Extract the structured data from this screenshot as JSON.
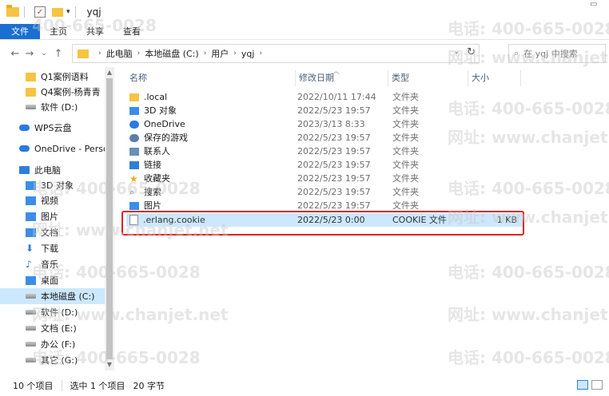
{
  "window": {
    "title": "yqj",
    "quick_access_dropdown": "▾"
  },
  "ribbon": {
    "tabs": [
      "文件",
      "主页",
      "共享",
      "查看"
    ]
  },
  "address": {
    "crumbs": [
      "此电脑",
      "本地磁盘 (C:)",
      "用户",
      "yqj"
    ],
    "search_placeholder": "在 yqj 中搜索"
  },
  "sidebar": {
    "items": [
      {
        "label": "Q1案例语料",
        "icon": "folder-icon"
      },
      {
        "label": "Q4案例-杨青青",
        "icon": "folder-icon"
      },
      {
        "label": "软件 (D:)",
        "icon": "drive-icon"
      },
      {
        "label": "WPS云盘",
        "icon": "cloud-icon"
      },
      {
        "label": "OneDrive - Person",
        "icon": "onedrive-icon"
      },
      {
        "label": "此电脑",
        "icon": "pc-icon"
      },
      {
        "label": "3D 对象",
        "icon": "cube-icon"
      },
      {
        "label": "视频",
        "icon": "video-icon"
      },
      {
        "label": "图片",
        "icon": "picture-icon"
      },
      {
        "label": "文档",
        "icon": "document-icon"
      },
      {
        "label": "下载",
        "icon": "download-icon"
      },
      {
        "label": "音乐",
        "icon": "music-icon"
      },
      {
        "label": "桌面",
        "icon": "desktop-icon"
      },
      {
        "label": "本地磁盘 (C:)",
        "icon": "drive-icon",
        "selected": true
      },
      {
        "label": "软件 (D:)",
        "icon": "drive-icon"
      },
      {
        "label": "文档 (E:)",
        "icon": "drive-icon"
      },
      {
        "label": "办公 (F:)",
        "icon": "drive-icon"
      },
      {
        "label": "其它 (G:)",
        "icon": "drive-icon"
      }
    ]
  },
  "columns": {
    "name": "名称",
    "date": "修改日期",
    "type": "类型",
    "size": "大小"
  },
  "files": [
    {
      "name": ".local",
      "date": "2022/10/11 17:44",
      "type": "文件夹",
      "size": "",
      "icon": "folder-icon"
    },
    {
      "name": "3D 对象",
      "date": "2022/5/23 19:57",
      "type": "文件夹",
      "size": "",
      "icon": "cube-icon"
    },
    {
      "name": "OneDrive",
      "date": "2023/3/13 8:33",
      "type": "文件夹",
      "size": "",
      "icon": "onedrive-icon"
    },
    {
      "name": "保存的游戏",
      "date": "2022/5/23 19:57",
      "type": "文件夹",
      "size": "",
      "icon": "games-icon"
    },
    {
      "name": "联系人",
      "date": "2022/5/23 19:57",
      "type": "文件夹",
      "size": "",
      "icon": "contacts-icon"
    },
    {
      "name": "链接",
      "date": "2022/5/23 19:57",
      "type": "文件夹",
      "size": "",
      "icon": "link-icon"
    },
    {
      "name": "收藏夹",
      "date": "2022/5/23 19:57",
      "type": "文件夹",
      "size": "",
      "icon": "star-icon"
    },
    {
      "name": "搜索",
      "date": "2022/5/23 19:57",
      "type": "文件夹",
      "size": "",
      "icon": "search-icon"
    },
    {
      "name": "图片",
      "date": "2022/5/23 19:57",
      "type": "文件夹",
      "size": "",
      "icon": "picture-icon"
    },
    {
      "name": ".erlang.cookie",
      "date": "2022/5/23 0:00",
      "type": "COOKIE 文件",
      "size": "1 KB",
      "icon": "file-icon",
      "selected": true
    }
  ],
  "status": {
    "count": "10 个项目",
    "selected": "选中 1 个项目",
    "size": "20 字节"
  },
  "watermark": {
    "phone": "电话: 400-665-0028",
    "site": "网址: www.chanjet.net",
    "phone_short": "400-665-0028"
  }
}
